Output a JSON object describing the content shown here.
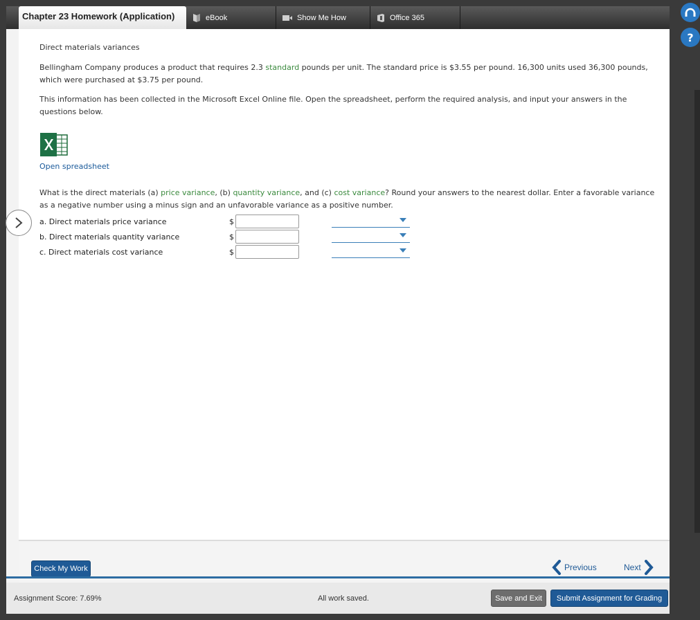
{
  "header": {
    "chapter_title": "Chapter 23 Homework (Application)",
    "tabs": [
      {
        "label": "eBook",
        "icon": "book-icon"
      },
      {
        "label": "Show Me How",
        "icon": "video-icon"
      },
      {
        "label": "Office 365",
        "icon": "office-icon"
      }
    ]
  },
  "problem": {
    "title": "Direct materials variances",
    "para_before": "Bellingham Company produces a product that requires 2.3 ",
    "para_link": "standard",
    "para_after": " pounds per unit. The standard price is $3.55 per pound. 16,300 units used 36,300 pounds, which were purchased at $3.75 per pound.",
    "info": "This information has been collected in the Microsoft Excel Online file. Open the spreadsheet, perform the required analysis, and input your answers in the questions below.",
    "open_link": "Open spreadsheet",
    "question": {
      "part1": "What is the direct materials (a) ",
      "link1": "price variance",
      "part2": ", (b) ",
      "link2": "quantity variance",
      "part3": ", and (c) ",
      "link3": "cost variance",
      "part4": "? Round your answers to the nearest dollar. Enter a favorable variance as a negative number using a minus sign and an unfavorable variance as a positive number."
    },
    "rows": [
      {
        "label": "a. Direct materials price variance",
        "currency": "$",
        "value": "",
        "selection": ""
      },
      {
        "label": "b. Direct materials quantity variance",
        "currency": "$",
        "value": "",
        "selection": ""
      },
      {
        "label": "c. Direct materials cost variance",
        "currency": "$",
        "value": "",
        "selection": ""
      }
    ]
  },
  "actions": {
    "check_label": "Check My Work",
    "previous_label": "Previous",
    "next_label": "Next"
  },
  "footer": {
    "score": "Assignment Score: 7.69%",
    "saved": "All work saved.",
    "save_exit": "Save and Exit",
    "submit": "Submit Assignment for Grading"
  },
  "colors": {
    "accent_blue": "#1f5a96",
    "link_green": "#3b8a3e"
  }
}
